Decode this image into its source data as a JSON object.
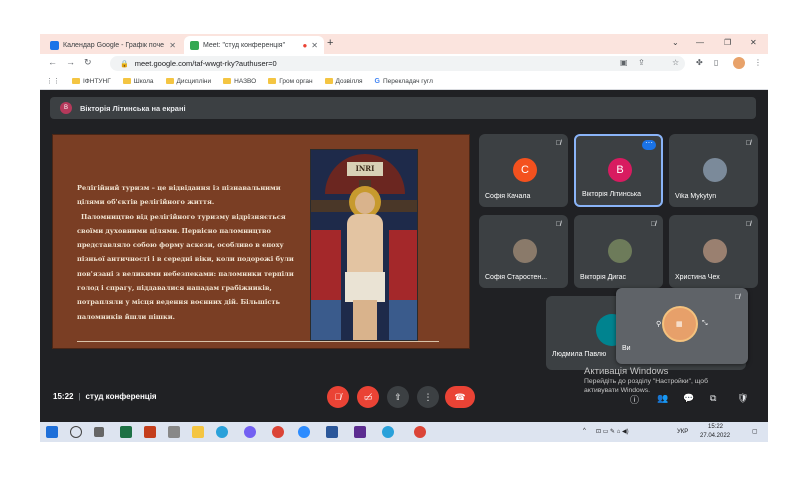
{
  "browser": {
    "tabs": [
      {
        "title": "Календар Google - Графік поче",
        "active": false
      },
      {
        "title": "Meet: \"студ конференція\"",
        "active": true
      }
    ],
    "url": "meet.google.com/taf-wwgt-rky?authuser=0",
    "bookmarks": [
      "ІФНТУНГ",
      "Школа",
      "Дисципліни",
      "НАЗВО",
      "Гром орган",
      "Дозвілля",
      "Перекладач гугл"
    ]
  },
  "meet": {
    "presenting_banner": "Вікторія Літинська на екрані",
    "presenter_initial": "В",
    "slide": {
      "paragraph1": "Релігійний туризм – це відвідання із пізнавальними цілями об'єктів релігійного життя.",
      "paragraph2": "Паломництво від релігійного туризму відрізняється своїми духовними цілями. Первісно паломництво представляло собою форму аскези, особливо в епоху пізньої античності і в середні віки, коли подорожі були пов'язані з великими небезпеками: паломники терпіли голод і спрагу, піддавалися нападам грабіжників, потрапляли у місця ведення воєнних дій. Більшість паломників йшли пішки.",
      "inri": "INRI"
    },
    "participants": [
      {
        "name": "Софія Качала",
        "initial": "С",
        "color": "#f4511e"
      },
      {
        "name": "Вікторія Літинська",
        "initial": "В",
        "color": "#d81b60"
      },
      {
        "name": "Vika Mykytyn",
        "initial": "",
        "color": "#7b8a9a"
      },
      {
        "name": "Софія Старостен...",
        "initial": "",
        "color": "#8a7a6a"
      },
      {
        "name": "Вікторія Дигас",
        "initial": "",
        "color": "#6d7b5a"
      },
      {
        "name": "Христина Чех",
        "initial": "",
        "color": "#9a8070"
      }
    ],
    "big_participant": "Людмила Павлю",
    "self_label": "Ви",
    "time": "15:22",
    "meeting_name": "студ конференція"
  },
  "windows_watermark": {
    "line1": "Активація Windows",
    "line2": "Перейдіть до розділу \"Настройки\", щоб активувати Windows."
  },
  "taskbar": {
    "lang": "УКР",
    "time": "15:22",
    "date": "27.04.2022"
  }
}
